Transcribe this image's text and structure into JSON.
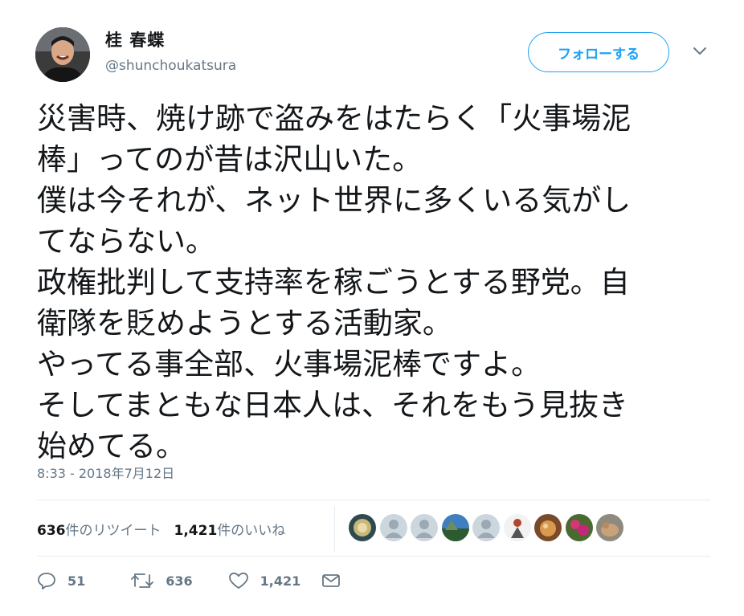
{
  "user": {
    "display_name": "桂 春蝶",
    "handle": "@shunchoukatsura",
    "avatar_icon": "user-avatar"
  },
  "follow_button": {
    "label": "フォローする",
    "color": "#1da1f2"
  },
  "menu_caret_icon": "chevron-down-icon",
  "tweet": {
    "lines": [
      "災害時、焼け跡で盗みをはたらく「火事場泥",
      "棒」ってのが昔は沢山いた。",
      "僕は今それが、ネット世界に多くいる気がし",
      "てならない。",
      "政権批判して支持率を稼ごうとする野党。自",
      "衛隊を貶めようとする活動家。",
      "やってる事全部、火事場泥棒ですよ。",
      "そしてまともな日本人は、それをもう見抜き",
      "始めてる。"
    ],
    "timestamp": "8:33 - 2018年7月12日"
  },
  "stats": {
    "retweets_count": "636",
    "retweets_label": "件のリツイート",
    "likes_count": "1,421",
    "likes_label": "件のいいね"
  },
  "likers": [
    {
      "icon": "liker-avatar-1"
    },
    {
      "icon": "default-avatar"
    },
    {
      "icon": "default-avatar"
    },
    {
      "icon": "liker-avatar-landscape"
    },
    {
      "icon": "default-avatar"
    },
    {
      "icon": "liker-avatar-figure"
    },
    {
      "icon": "liker-avatar-food"
    },
    {
      "icon": "liker-avatar-flowers"
    },
    {
      "icon": "liker-avatar-animal"
    }
  ],
  "actions": {
    "reply_count": "51",
    "retweet_count": "636",
    "like_count": "1,421"
  },
  "colors": {
    "text": "#14171a",
    "secondary": "#657786",
    "divider": "#e6ecf0",
    "accent": "#1da1f2"
  }
}
